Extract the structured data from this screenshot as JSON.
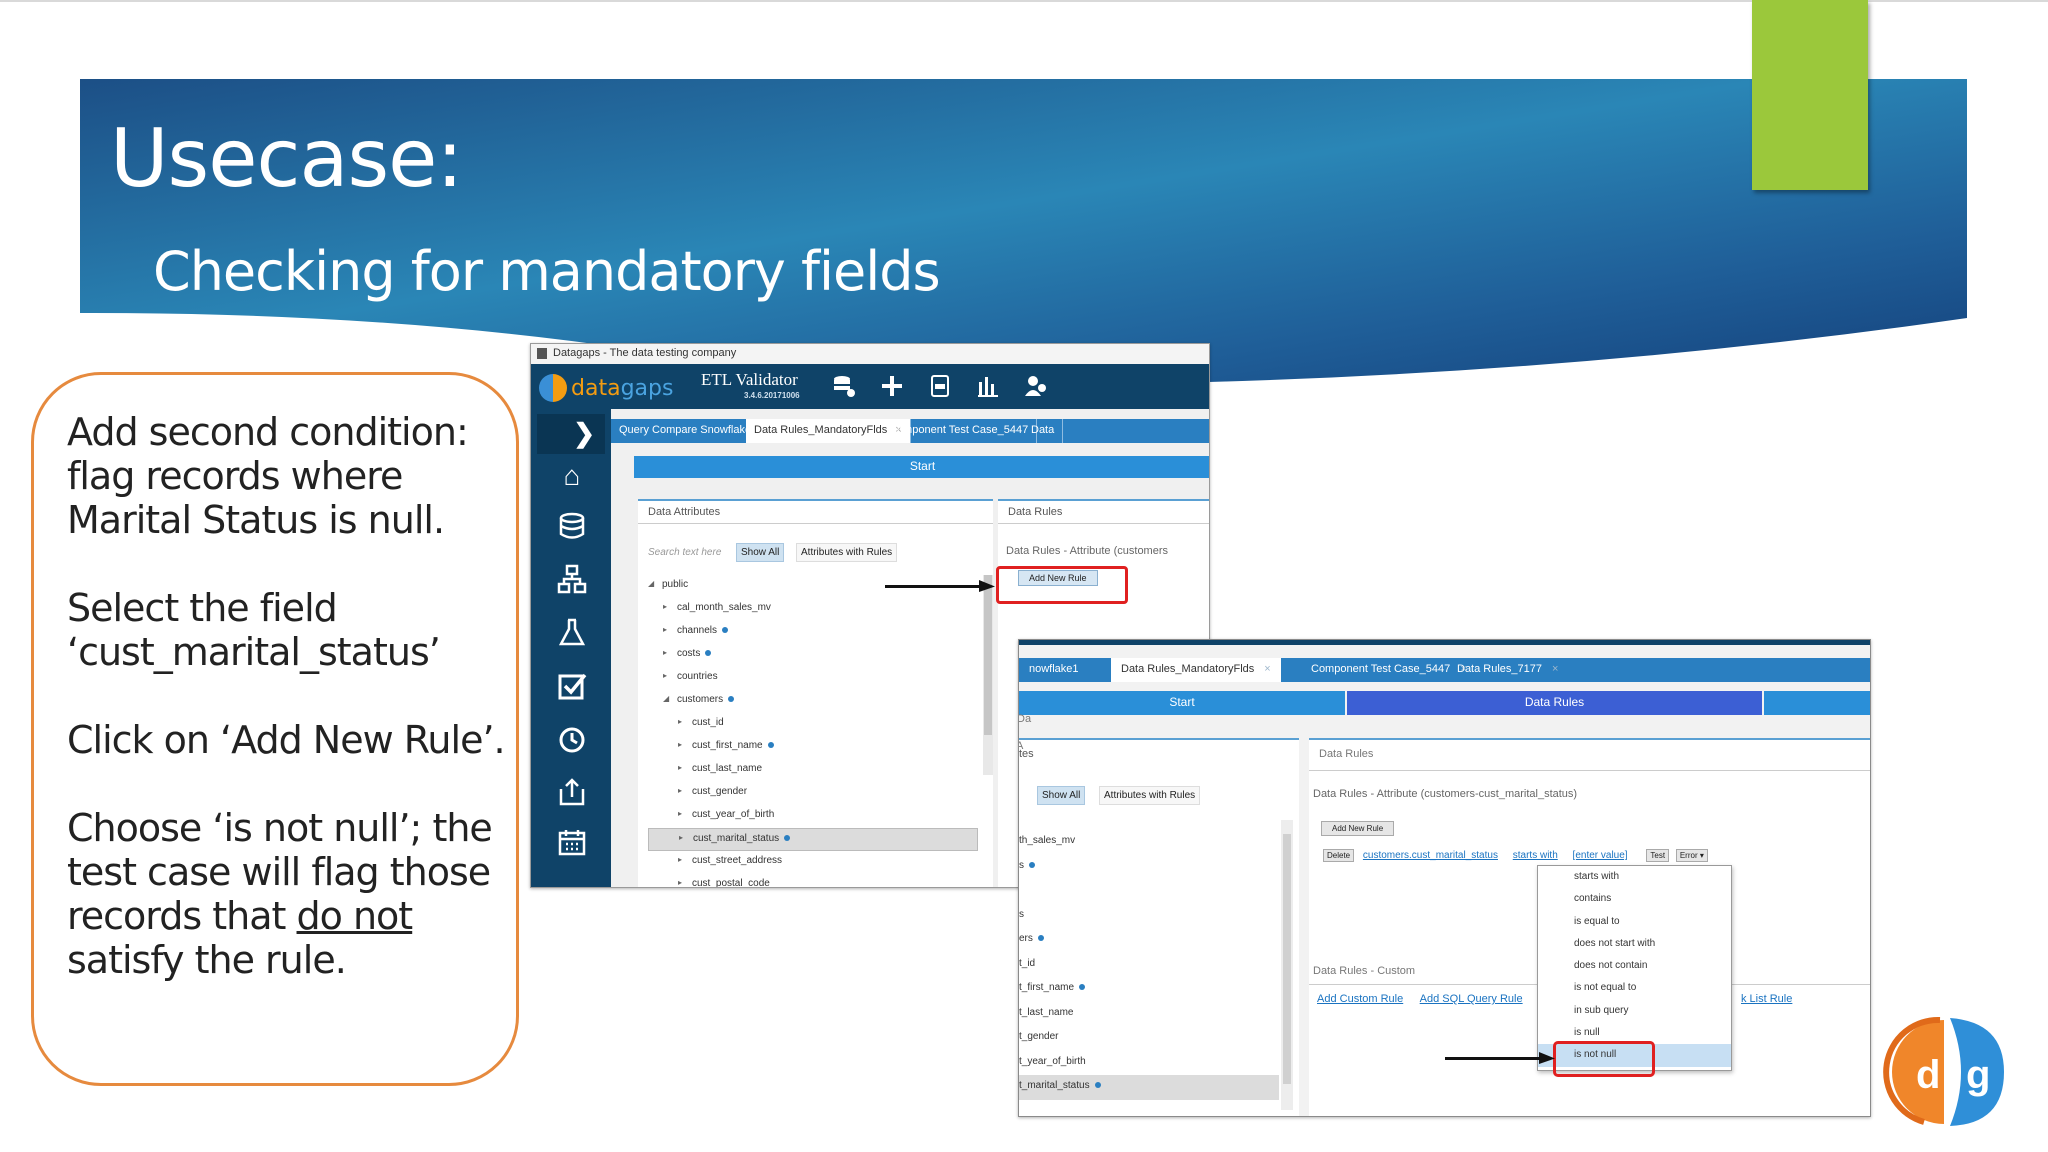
{
  "slide": {
    "title": "Usecase:",
    "subtitle": "Checking for mandatory fields",
    "colors": {
      "banner_dark": "#123f7a",
      "banner_light": "#3ba3cf",
      "accent_green": "#9bc83b",
      "callout_border": "#e68a3e",
      "highlight_red": "#e02020"
    }
  },
  "callout": {
    "p1": "Add second condition: flag records where Marital Status is null.",
    "p2": "Select the field ‘cust_marital_status’",
    "p3": "Click on ‘Add New Rule’.",
    "p4_before": "Choose ‘is not null’; the test case will flag those records that ",
    "p4_underlined": "do not",
    "p4_after": " satisfy the rule."
  },
  "screenshot1": {
    "window_title": "Datagaps - The data testing company",
    "logo_word_a": "data",
    "logo_word_b": "gaps",
    "product": "ETL Validator",
    "version": "3.4.6.20171006",
    "toolbar_icons": [
      "database-stack-icon",
      "plus-icon",
      "sql-file-icon",
      "bar-chart-icon",
      "users-icon"
    ],
    "sidebar_icons": [
      "home-icon",
      "database-icon",
      "hierarchy-icon",
      "flask-icon",
      "checkbox-icon",
      "history-icon",
      "export-icon",
      "calendar-icon"
    ],
    "tabs": [
      {
        "label": "Query Compare Snowflake1"
      },
      {
        "label": "Data Rules_MandatoryFlds",
        "active": true
      },
      {
        "label": "Component Test Case_5447"
      },
      {
        "label": "Data"
      }
    ],
    "start_label": "Start",
    "attributes_panel": {
      "title": "Data Attributes",
      "search_placeholder": "Search text here",
      "show_all": "Show All",
      "attributes_with_rules": "Attributes with Rules",
      "tree": [
        {
          "label": "public",
          "indent": 0,
          "expanded": true
        },
        {
          "label": "cal_month_sales_mv",
          "indent": 1
        },
        {
          "label": "channels",
          "indent": 1,
          "dot": true
        },
        {
          "label": "costs",
          "indent": 1,
          "dot": true
        },
        {
          "label": "countries",
          "indent": 1
        },
        {
          "label": "customers",
          "indent": 1,
          "dot": true,
          "expanded": true
        },
        {
          "label": "cust_id",
          "indent": 2
        },
        {
          "label": "cust_first_name",
          "indent": 2,
          "dot": true
        },
        {
          "label": "cust_last_name",
          "indent": 2
        },
        {
          "label": "cust_gender",
          "indent": 2
        },
        {
          "label": "cust_year_of_birth",
          "indent": 2
        },
        {
          "label": "cust_marital_status",
          "indent": 2,
          "dot": true,
          "selected": true
        },
        {
          "label": "cust_street_address",
          "indent": 2
        },
        {
          "label": "cust_postal_code",
          "indent": 2
        }
      ]
    },
    "rules_panel": {
      "title": "Data Rules",
      "subtitle": "Data Rules - Attribute (customers",
      "add_new_rule": "Add New Rule"
    }
  },
  "screenshot2": {
    "tabs": [
      {
        "label": "nowflake1"
      },
      {
        "label": "Data Rules_MandatoryFlds",
        "active": true
      },
      {
        "label": "Component Test Case_5447"
      },
      {
        "label": "Data Rules_7177"
      }
    ],
    "nav_start": "Start",
    "nav_rules": "Data Rules",
    "left_label_top": "Da",
    "left_label_attr": "A",
    "left_title": "tes",
    "show_all": "Show All",
    "attributes_with_rules": "Attributes with Rules",
    "tree": [
      {
        "label": "th_sales_mv"
      },
      {
        "label": "s",
        "dot": true
      },
      {
        "label": ""
      },
      {
        "label": "s"
      },
      {
        "label": "ers",
        "dot": true
      },
      {
        "label": "t_id"
      },
      {
        "label": "t_first_name",
        "dot": true
      },
      {
        "label": "t_last_name"
      },
      {
        "label": "t_gender"
      },
      {
        "label": "t_year_of_birth"
      },
      {
        "label": "t_marital_status",
        "dot": true,
        "selected": true
      }
    ],
    "rules_title": "Data Rules",
    "rules_subtitle": "Data Rules - Attribute (customers-cust_marital_status)",
    "add_new_rule": "Add New Rule",
    "rule_delete": "Delete",
    "rule_field": "customers.cust_marital_status",
    "rule_operator": "starts with",
    "rule_value": "[enter value]",
    "rule_test": "Test",
    "rule_severity": "Error",
    "custom_title": "Data Rules - Custom",
    "add_custom_rule": "Add Custom Rule",
    "add_sql_query_rule": "Add SQL Query Rule",
    "list_rule_fragment": "k List Rule",
    "operator_options": [
      "starts with",
      "contains",
      "is equal to",
      "does not start with",
      "does not contain",
      "is not equal to",
      "in sub query",
      "is null",
      "is not null"
    ],
    "highlighted_option": "is not null"
  },
  "corner_logo": {
    "left": "d",
    "right": "g"
  }
}
